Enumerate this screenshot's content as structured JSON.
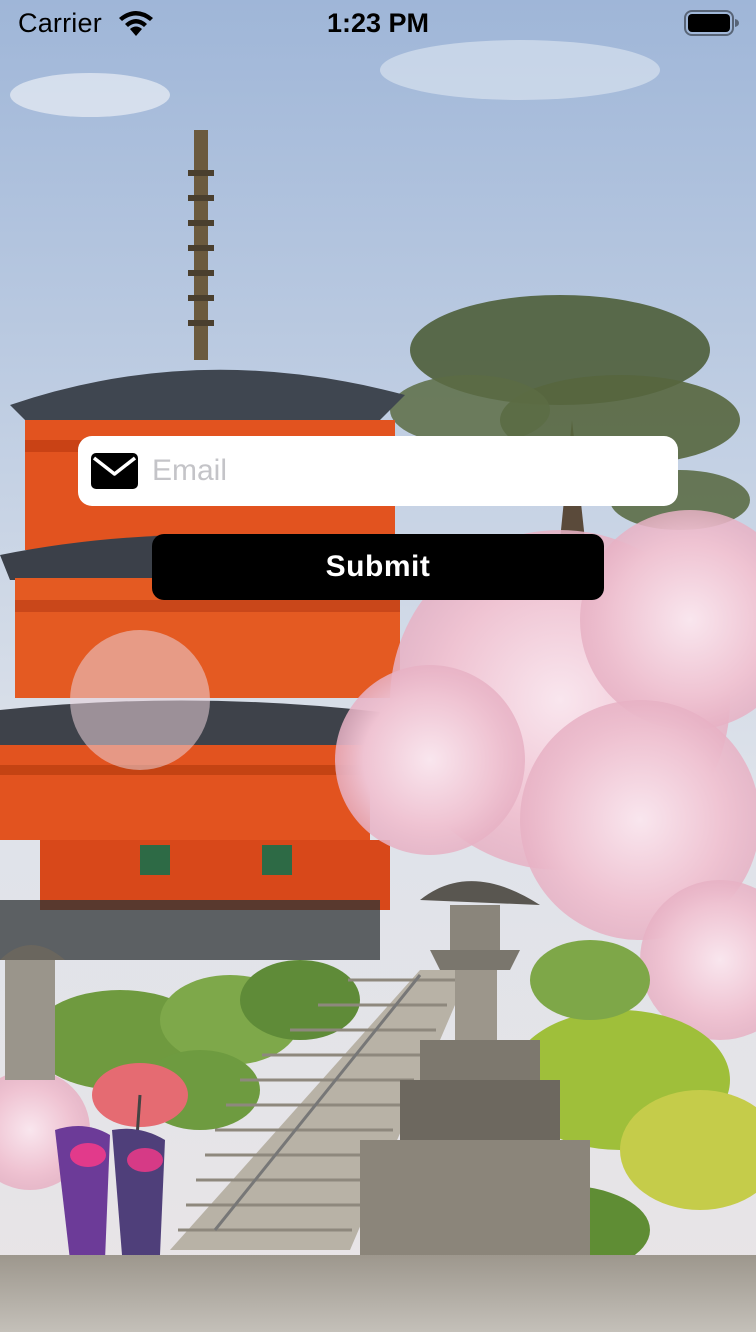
{
  "status_bar": {
    "carrier": "Carrier",
    "time": "1:23 PM",
    "wifi_icon": "wifi-icon",
    "battery_icon": "battery-icon"
  },
  "background": {
    "scene": "photo-background",
    "colors": {
      "sky": "#b8c8e0",
      "pagoda": "#e0501e",
      "blossom": "#f1c9d6",
      "foliage": "#7fa54a",
      "stone": "#8f8a80"
    }
  },
  "form": {
    "email": {
      "icon": "mail-icon",
      "placeholder": "Email",
      "value": ""
    },
    "submit_label": "Submit"
  }
}
